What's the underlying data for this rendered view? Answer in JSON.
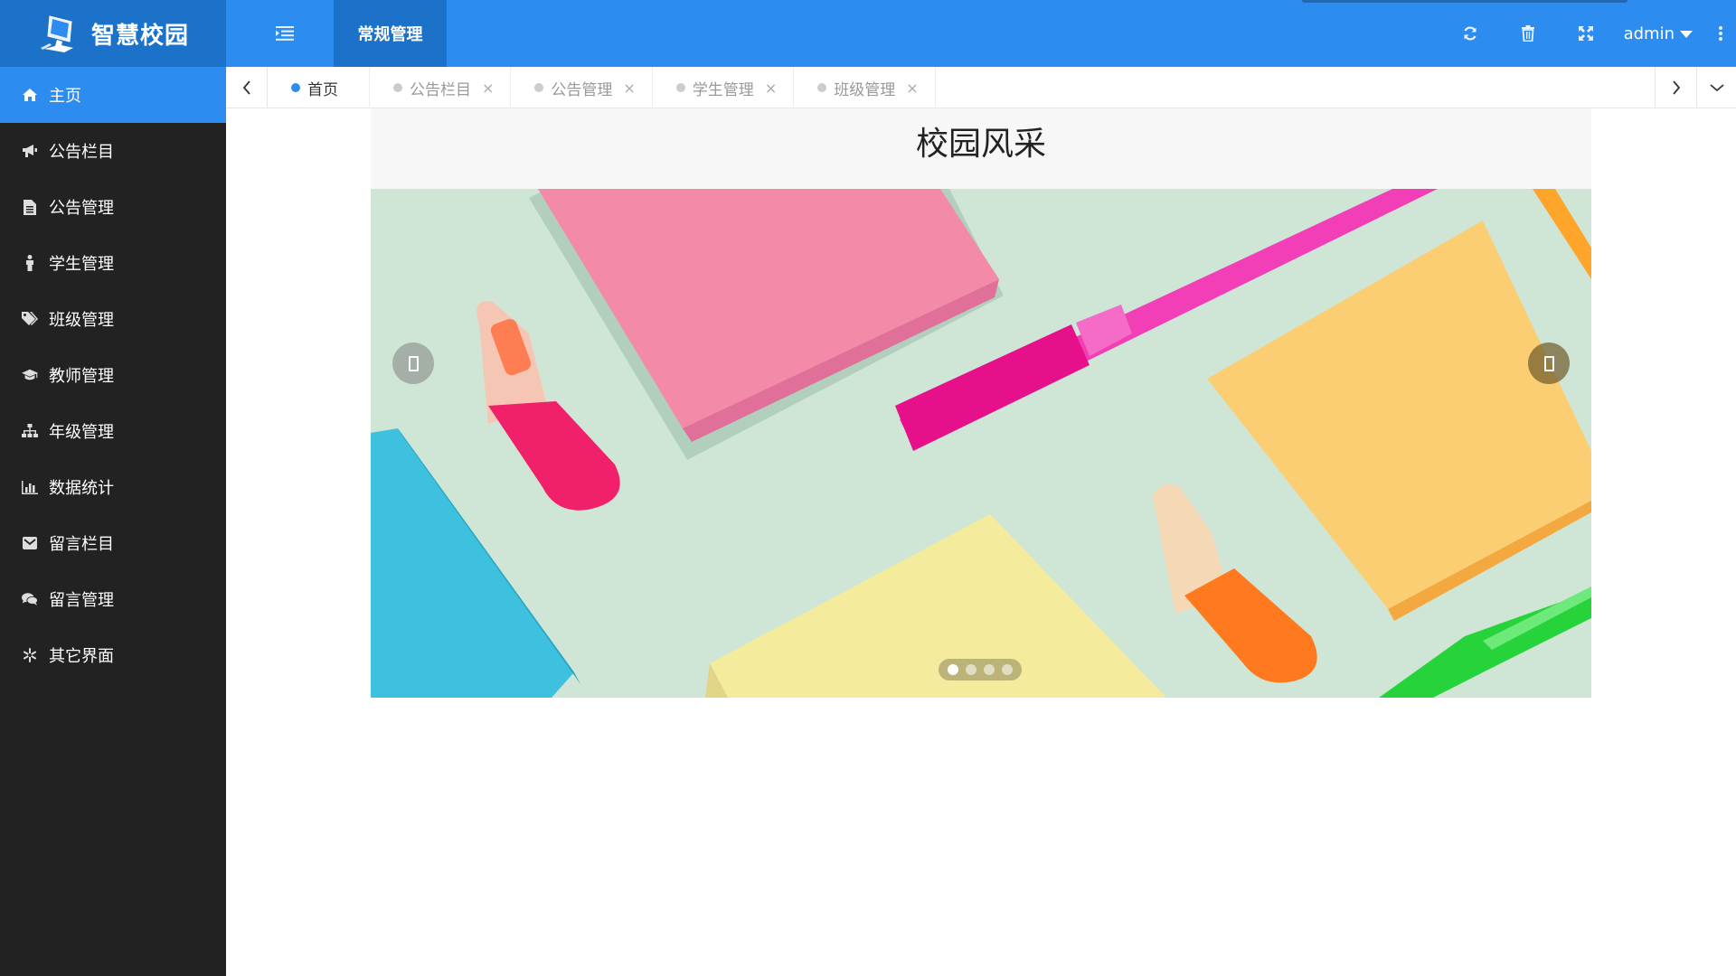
{
  "app": {
    "title": "智慧校园"
  },
  "header": {
    "menu_toggle_icon": "list-indent-icon",
    "active_nav": "常规管理",
    "icons": [
      "refresh-icon",
      "trash-icon",
      "fullscreen-icon"
    ],
    "user": "admin",
    "more_icon": "vertical-ellipsis-icon",
    "colors": {
      "primary": "#2d8cf0",
      "primary_dark": "#1c71c9",
      "sidebar": "#222222"
    }
  },
  "sidebar": {
    "items": [
      {
        "label": "主页",
        "icon": "home-icon",
        "active": true
      },
      {
        "label": "公告栏目",
        "icon": "bullhorn-icon"
      },
      {
        "label": "公告管理",
        "icon": "file-text-icon"
      },
      {
        "label": "学生管理",
        "icon": "male-icon"
      },
      {
        "label": "班级管理",
        "icon": "tags-icon"
      },
      {
        "label": "教师管理",
        "icon": "graduation-cap-icon"
      },
      {
        "label": "年级管理",
        "icon": "sitemap-icon"
      },
      {
        "label": "数据统计",
        "icon": "bar-chart-icon"
      },
      {
        "label": "留言栏目",
        "icon": "envelope-icon"
      },
      {
        "label": "留言管理",
        "icon": "comments-icon"
      },
      {
        "label": "其它界面",
        "icon": "snowflake-icon"
      }
    ]
  },
  "tabs": {
    "items": [
      {
        "label": "首页",
        "active": true,
        "closable": false
      },
      {
        "label": "公告栏目",
        "closable": true
      },
      {
        "label": "公告管理",
        "closable": true
      },
      {
        "label": "学生管理",
        "closable": true
      },
      {
        "label": "班级管理",
        "closable": true
      }
    ],
    "close_glyph": "×"
  },
  "main": {
    "title": "校园风采",
    "carousel": {
      "slide_count": 4,
      "active_index": 0
    }
  }
}
